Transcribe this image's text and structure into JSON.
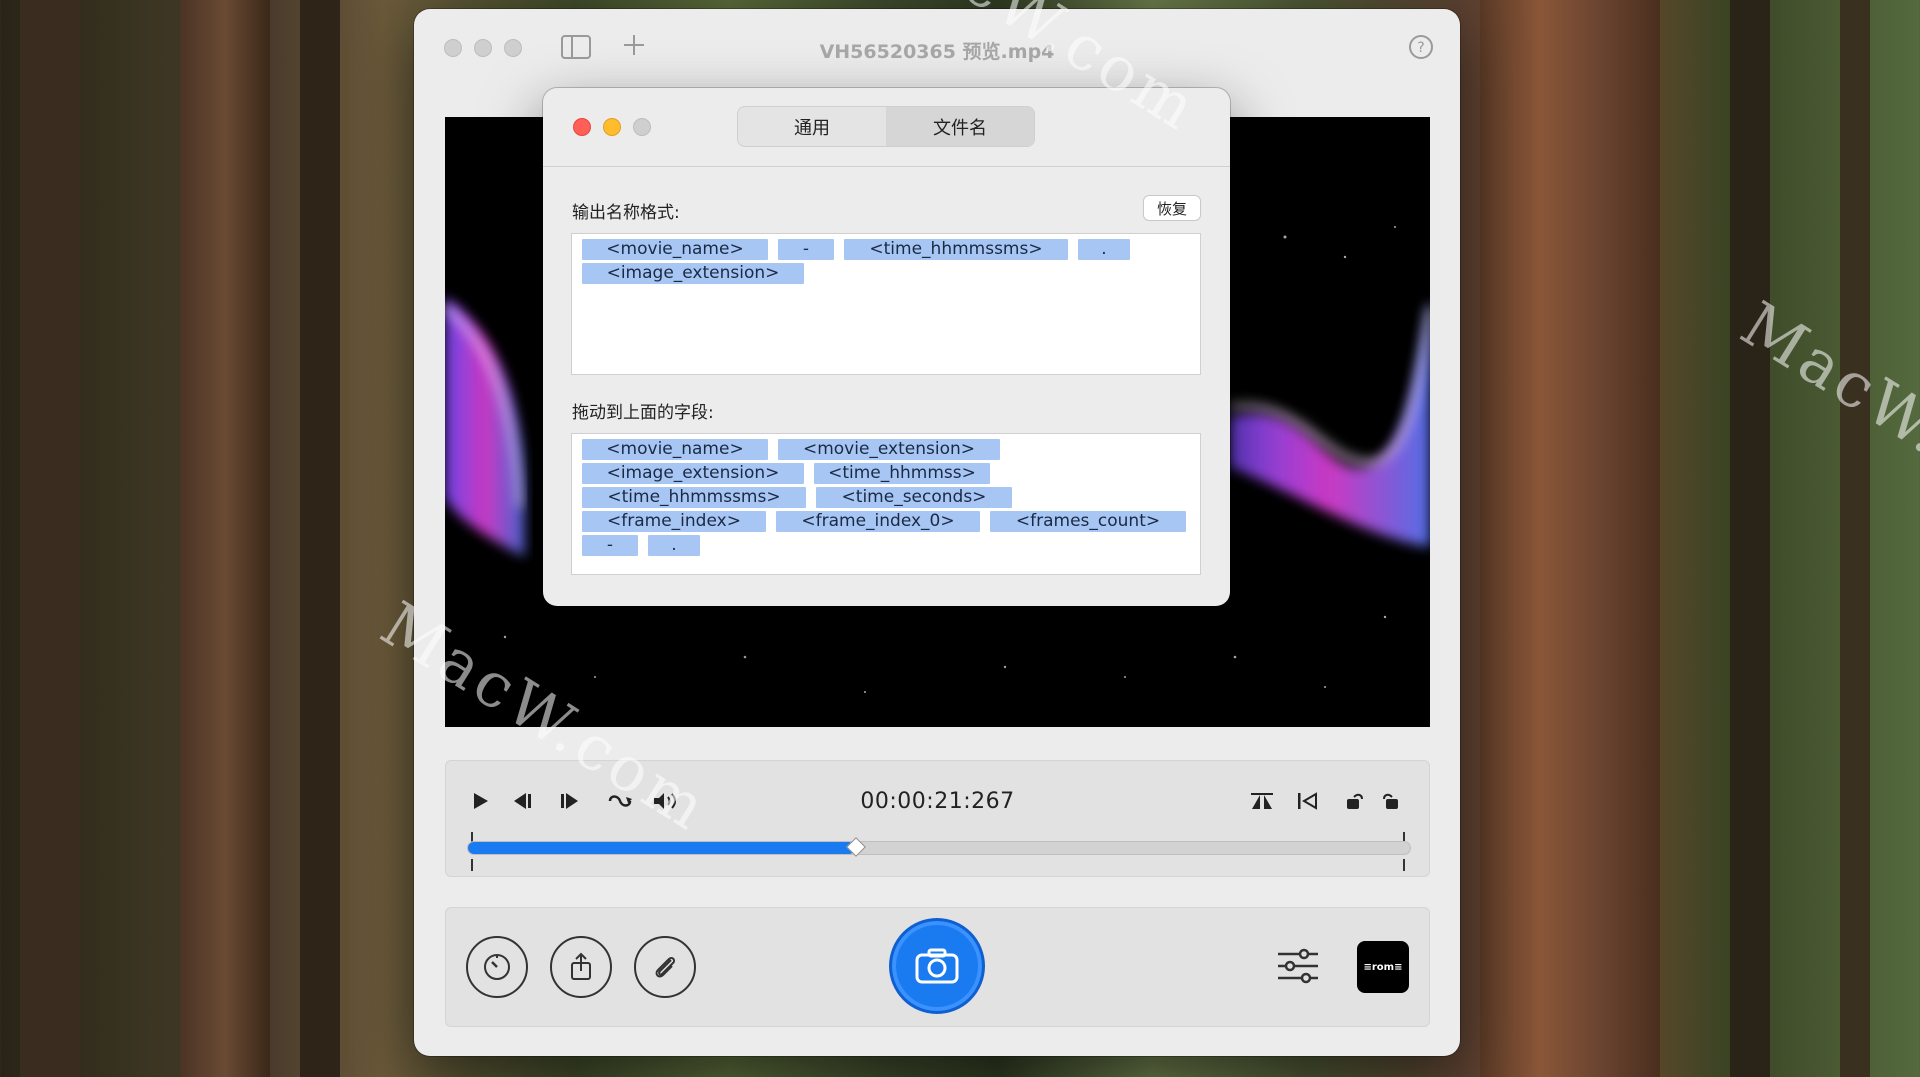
{
  "window": {
    "title": "VH56520365 预览.mp4",
    "help_icon": "question-circle-icon",
    "sidebar_icon": "sidebar-toggle-icon",
    "add_icon": "plus-icon"
  },
  "player": {
    "timecode": "00:00:21:267",
    "progress_fraction": 0.41,
    "icons": [
      "play-icon",
      "step-back-icon",
      "step-forward-icon",
      "loop-icon",
      "volume-icon",
      "flip-icon",
      "trim-start-icon",
      "rotate-left-icon",
      "rotate-right-icon"
    ]
  },
  "bottom": {
    "icons": [
      "timer-icon",
      "share-icon",
      "attach-icon",
      "camera-icon",
      "sliders-icon"
    ],
    "logo_text": "≡rom≡"
  },
  "dialog": {
    "tabs": [
      {
        "label": "通用",
        "active": false
      },
      {
        "label": "文件名",
        "active": true
      }
    ],
    "output_label": "输出名称格式:",
    "restore_label": "恢复",
    "format_tokens": [
      "<movie_name>",
      "-",
      "<time_hhmmssms>",
      ".",
      "<image_extension>"
    ],
    "fields_label": "拖动到上面的字段:",
    "field_tokens": [
      "<movie_name>",
      "<movie_extension>",
      "<image_extension>",
      "<time_hhmmss>",
      "<time_hhmmssms>",
      "<time_seconds>",
      "<frame_index>",
      "<frame_index_0>",
      "<frames_count>",
      "-",
      "."
    ]
  },
  "watermark": "MacW.com",
  "colors": {
    "accent": "#1a7bf0",
    "tag": "#a8c6f4",
    "close": "#ff5f57",
    "minimize": "#febc2e",
    "zoom_disabled": "#cfcfcf"
  }
}
